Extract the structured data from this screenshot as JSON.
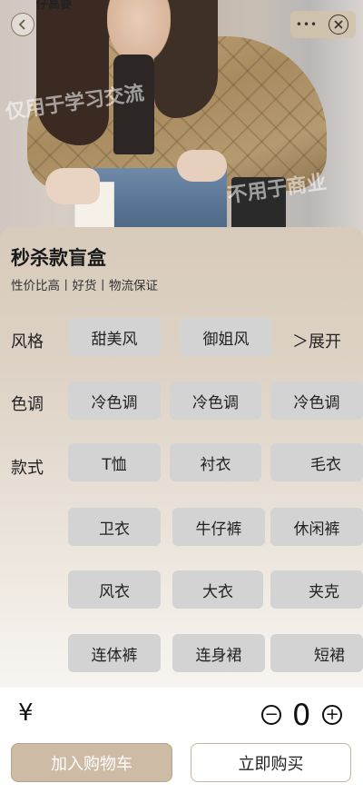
{
  "header": {
    "top_text": "仔高要",
    "back_icon": "chevron-left-icon",
    "more_label": "•••",
    "close_icon": "close-circle-icon",
    "watermark_1": "仅用于学习交流",
    "watermark_2": "不用于商业"
  },
  "product": {
    "title": "秒杀款盲盒",
    "subtitle": "性价比高丨好货丨物流保证"
  },
  "options": {
    "style_label": "风格",
    "style_items": [
      "甜美风",
      "御姐风"
    ],
    "expand_label": "＞展开",
    "tone_label": "色调",
    "tone_items": [
      "冷色调",
      "冷色调",
      "冷色调"
    ],
    "type_label": "款式",
    "type_items": [
      "T恤",
      "衬衣",
      "毛衣",
      "卫衣",
      "牛仔裤",
      "休闲裤",
      "风衣",
      "大衣",
      "夹克",
      "连体裤",
      "连身裙",
      "短裙"
    ]
  },
  "footer": {
    "currency": "¥",
    "quantity": "0",
    "minus_label": "−",
    "plus_label": "+",
    "add_to_cart": "加入购物车",
    "buy_now": "立即购买"
  },
  "colors": {
    "accent": "#cdbba5",
    "option_bg": "#d3d3d3"
  }
}
